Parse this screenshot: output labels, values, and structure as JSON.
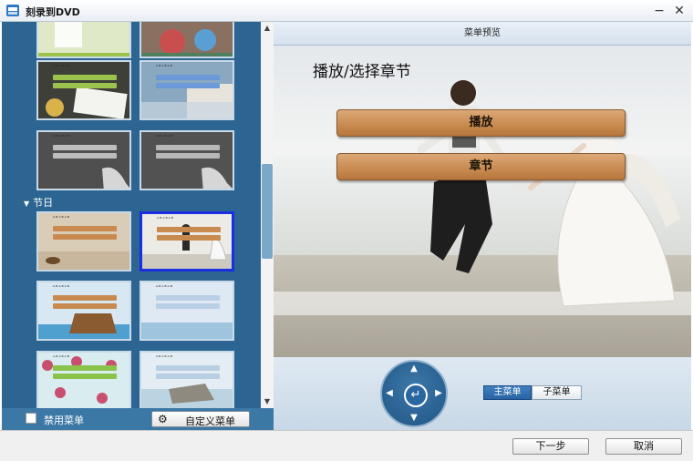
{
  "window": {
    "title": "刻录到DVD",
    "min_icon": "minimize-icon",
    "close_icon": "close-icon"
  },
  "templates": {
    "group_label": "节日",
    "thumb_label": "ᴬᴮᴬᴮᴬᴮ",
    "thumbs": [
      {
        "id": "1",
        "bg": "#dfe9c8",
        "bar": "#a8c878"
      },
      {
        "id": "2",
        "bg": "#8a7060",
        "bar": "#c08070"
      },
      {
        "id": "3",
        "bg": "#6a6a5a",
        "bar": "#9bc24a"
      },
      {
        "id": "4",
        "bg": "#8aa8c0",
        "bar": "#6a9ad8"
      },
      {
        "id": "5",
        "bg": "#4f4f4f",
        "bar": "#bdbdbd"
      },
      {
        "id": "6",
        "bg": "#525252",
        "bar": "#b8b8b8"
      },
      {
        "id": "7",
        "bg": "#d9cdb8",
        "bar": "#c88a4f"
      },
      {
        "id": "8",
        "bg": "#ecebe6",
        "bar": "#c88a4f"
      },
      {
        "id": "9",
        "bg": "#d8e8f2",
        "bar": "#c88a4f"
      },
      {
        "id": "10",
        "bg": "#dfe9f3",
        "bar": "#b9cfe6"
      },
      {
        "id": "11",
        "bg": "#d9ecef",
        "bar": "#8bc34a"
      },
      {
        "id": "12",
        "bg": "#e4edf3",
        "bar": "#b8cfe3"
      }
    ],
    "disable_menu_label": "禁用菜单",
    "custom_menu_label": "自定义菜单"
  },
  "preview": {
    "header": "菜单预览",
    "menu_title": "播放/选择章节",
    "play_label": "播放",
    "chapter_label": "章节"
  },
  "controls": {
    "main_menu": "主菜单",
    "sub_menu": "子菜单"
  },
  "footer": {
    "next": "下一步",
    "cancel": "取消"
  }
}
